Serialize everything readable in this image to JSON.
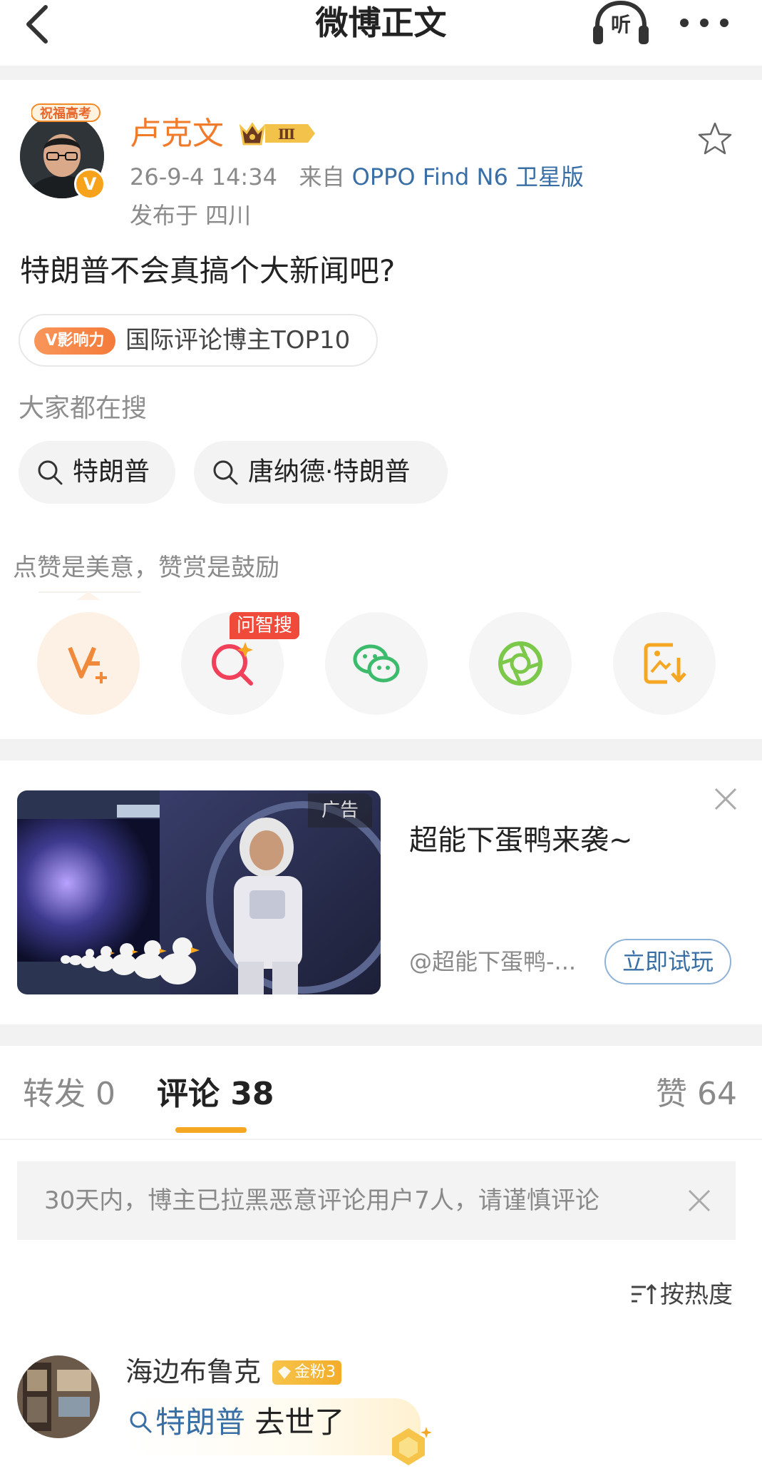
{
  "header": {
    "title": "微博正文",
    "listen_label": "听"
  },
  "post": {
    "author": "卢克文",
    "avatar_badge": "祝福高考",
    "verified_mark": "V",
    "member_level": "Ⅲ",
    "time": "26-9-4 14:34",
    "source_prefix": "来自",
    "source": "OPPO Find N6 卫星版",
    "location": "发布于 四川",
    "text": "特朗普不会真搞个大新闻吧?",
    "influence_tag": "V影响力",
    "influence_text": "国际评论博主TOP10",
    "search_hint": "大家都在搜",
    "search_chips": [
      "特朗普",
      "唐纳德·特朗普"
    ],
    "encourage_text": "点赞是美意，赞赏是鼓励",
    "wenzhisou_label": "问智搜"
  },
  "ad": {
    "label": "广告",
    "title": "超能下蛋鸭来袭~",
    "source": "@超能下蛋鸭-...",
    "button": "立即试玩"
  },
  "tabs": {
    "repost": "转发 0",
    "comment": "评论 38",
    "like": "赞 64"
  },
  "notice": {
    "text": "30天内，博主已拉黑恶意评论用户7人，请谨慎评论"
  },
  "sort": {
    "label": "按热度"
  },
  "comment": {
    "user": "海边布鲁克",
    "badge": "金粉3",
    "link_text": "特朗普",
    "text": "去世了"
  },
  "colors": {
    "accent_orange": "#f07b2a",
    "link_blue": "#3a6fa5",
    "tab_underline": "#f5a623",
    "badge_red": "#f04a3a"
  },
  "icons": [
    "back-icon",
    "listen-icon",
    "more-icon",
    "star-icon",
    "search-icon",
    "reward-icon",
    "smart-search-icon",
    "wechat-icon",
    "moments-icon",
    "save-image-icon",
    "close-icon",
    "sort-icon",
    "trophy-icon"
  ]
}
